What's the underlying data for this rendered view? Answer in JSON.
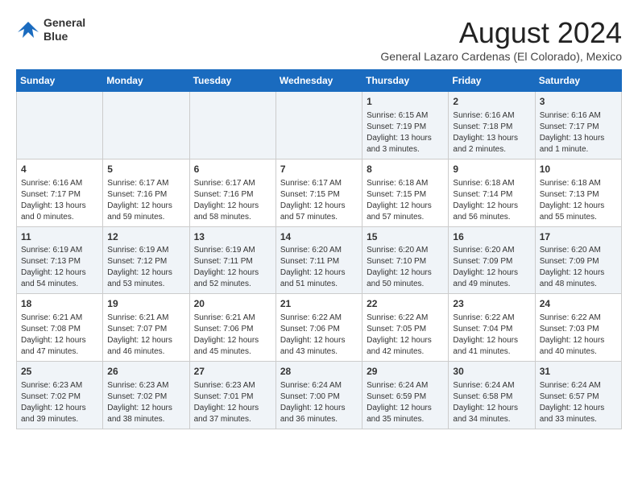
{
  "header": {
    "logo_line1": "General",
    "logo_line2": "Blue",
    "month": "August 2024",
    "location": "General Lazaro Cardenas (El Colorado), Mexico"
  },
  "days_of_week": [
    "Sunday",
    "Monday",
    "Tuesday",
    "Wednesday",
    "Thursday",
    "Friday",
    "Saturday"
  ],
  "weeks": [
    [
      {
        "day": "",
        "info": ""
      },
      {
        "day": "",
        "info": ""
      },
      {
        "day": "",
        "info": ""
      },
      {
        "day": "",
        "info": ""
      },
      {
        "day": "1",
        "info": "Sunrise: 6:15 AM\nSunset: 7:19 PM\nDaylight: 13 hours\nand 3 minutes."
      },
      {
        "day": "2",
        "info": "Sunrise: 6:16 AM\nSunset: 7:18 PM\nDaylight: 13 hours\nand 2 minutes."
      },
      {
        "day": "3",
        "info": "Sunrise: 6:16 AM\nSunset: 7:17 PM\nDaylight: 13 hours\nand 1 minute."
      }
    ],
    [
      {
        "day": "4",
        "info": "Sunrise: 6:16 AM\nSunset: 7:17 PM\nDaylight: 13 hours\nand 0 minutes."
      },
      {
        "day": "5",
        "info": "Sunrise: 6:17 AM\nSunset: 7:16 PM\nDaylight: 12 hours\nand 59 minutes."
      },
      {
        "day": "6",
        "info": "Sunrise: 6:17 AM\nSunset: 7:16 PM\nDaylight: 12 hours\nand 58 minutes."
      },
      {
        "day": "7",
        "info": "Sunrise: 6:17 AM\nSunset: 7:15 PM\nDaylight: 12 hours\nand 57 minutes."
      },
      {
        "day": "8",
        "info": "Sunrise: 6:18 AM\nSunset: 7:15 PM\nDaylight: 12 hours\nand 57 minutes."
      },
      {
        "day": "9",
        "info": "Sunrise: 6:18 AM\nSunset: 7:14 PM\nDaylight: 12 hours\nand 56 minutes."
      },
      {
        "day": "10",
        "info": "Sunrise: 6:18 AM\nSunset: 7:13 PM\nDaylight: 12 hours\nand 55 minutes."
      }
    ],
    [
      {
        "day": "11",
        "info": "Sunrise: 6:19 AM\nSunset: 7:13 PM\nDaylight: 12 hours\nand 54 minutes."
      },
      {
        "day": "12",
        "info": "Sunrise: 6:19 AM\nSunset: 7:12 PM\nDaylight: 12 hours\nand 53 minutes."
      },
      {
        "day": "13",
        "info": "Sunrise: 6:19 AM\nSunset: 7:11 PM\nDaylight: 12 hours\nand 52 minutes."
      },
      {
        "day": "14",
        "info": "Sunrise: 6:20 AM\nSunset: 7:11 PM\nDaylight: 12 hours\nand 51 minutes."
      },
      {
        "day": "15",
        "info": "Sunrise: 6:20 AM\nSunset: 7:10 PM\nDaylight: 12 hours\nand 50 minutes."
      },
      {
        "day": "16",
        "info": "Sunrise: 6:20 AM\nSunset: 7:09 PM\nDaylight: 12 hours\nand 49 minutes."
      },
      {
        "day": "17",
        "info": "Sunrise: 6:20 AM\nSunset: 7:09 PM\nDaylight: 12 hours\nand 48 minutes."
      }
    ],
    [
      {
        "day": "18",
        "info": "Sunrise: 6:21 AM\nSunset: 7:08 PM\nDaylight: 12 hours\nand 47 minutes."
      },
      {
        "day": "19",
        "info": "Sunrise: 6:21 AM\nSunset: 7:07 PM\nDaylight: 12 hours\nand 46 minutes."
      },
      {
        "day": "20",
        "info": "Sunrise: 6:21 AM\nSunset: 7:06 PM\nDaylight: 12 hours\nand 45 minutes."
      },
      {
        "day": "21",
        "info": "Sunrise: 6:22 AM\nSunset: 7:06 PM\nDaylight: 12 hours\nand 43 minutes."
      },
      {
        "day": "22",
        "info": "Sunrise: 6:22 AM\nSunset: 7:05 PM\nDaylight: 12 hours\nand 42 minutes."
      },
      {
        "day": "23",
        "info": "Sunrise: 6:22 AM\nSunset: 7:04 PM\nDaylight: 12 hours\nand 41 minutes."
      },
      {
        "day": "24",
        "info": "Sunrise: 6:22 AM\nSunset: 7:03 PM\nDaylight: 12 hours\nand 40 minutes."
      }
    ],
    [
      {
        "day": "25",
        "info": "Sunrise: 6:23 AM\nSunset: 7:02 PM\nDaylight: 12 hours\nand 39 minutes."
      },
      {
        "day": "26",
        "info": "Sunrise: 6:23 AM\nSunset: 7:02 PM\nDaylight: 12 hours\nand 38 minutes."
      },
      {
        "day": "27",
        "info": "Sunrise: 6:23 AM\nSunset: 7:01 PM\nDaylight: 12 hours\nand 37 minutes."
      },
      {
        "day": "28",
        "info": "Sunrise: 6:24 AM\nSunset: 7:00 PM\nDaylight: 12 hours\nand 36 minutes."
      },
      {
        "day": "29",
        "info": "Sunrise: 6:24 AM\nSunset: 6:59 PM\nDaylight: 12 hours\nand 35 minutes."
      },
      {
        "day": "30",
        "info": "Sunrise: 6:24 AM\nSunset: 6:58 PM\nDaylight: 12 hours\nand 34 minutes."
      },
      {
        "day": "31",
        "info": "Sunrise: 6:24 AM\nSunset: 6:57 PM\nDaylight: 12 hours\nand 33 minutes."
      }
    ]
  ]
}
